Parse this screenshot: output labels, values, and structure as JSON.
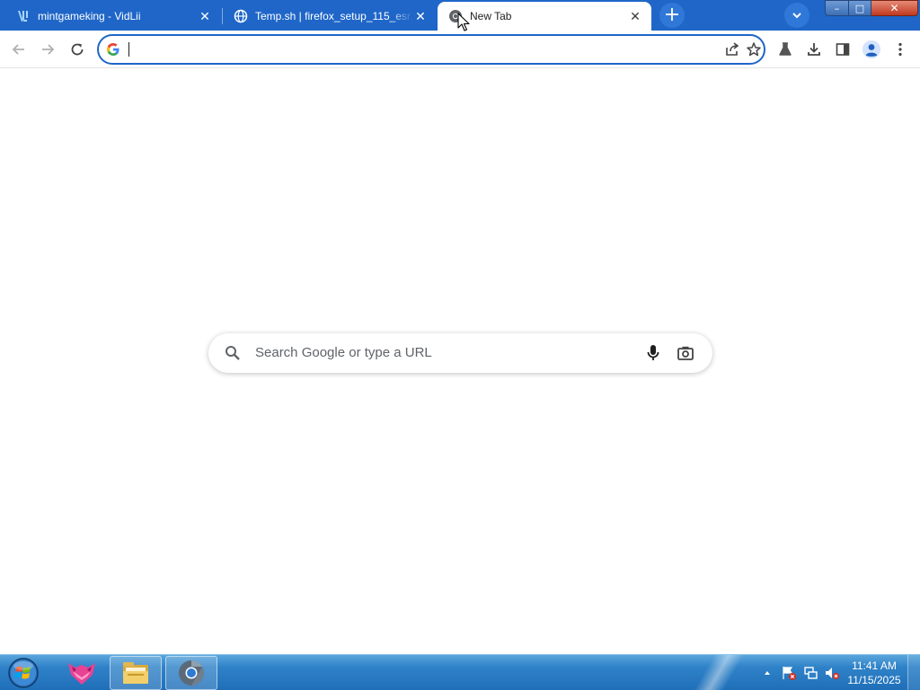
{
  "browser": {
    "tabs": [
      {
        "title": "mintgameking - VidLii",
        "favicon": "vidlii-icon",
        "active": false
      },
      {
        "title": "Temp.sh | firefox_setup_115_esr.e",
        "favicon": "globe-icon",
        "active": false
      },
      {
        "title": "New Tab",
        "favicon": "chrome-icon",
        "active": true
      }
    ],
    "new_tab_symbol": "+",
    "window_controls": {
      "minimize": "–",
      "maximize": "□",
      "close": "✕"
    }
  },
  "toolbar": {
    "address_value": "",
    "buttons": [
      "back-icon",
      "forward-icon",
      "reload-icon",
      "share-icon",
      "bookmark-star-icon",
      "labs-flask-icon",
      "download-icon",
      "side-panel-icon",
      "profile-icon",
      "menu-icon"
    ]
  },
  "ntp": {
    "search_placeholder": "Search Google or type a URL"
  },
  "taskbar": {
    "clock_time": "11:41 AM",
    "clock_date": "11/15/2025",
    "pinned": [
      "start-orb-icon",
      "app-fox-icon",
      "file-explorer-icon",
      "chrome-icon"
    ]
  },
  "colors": {
    "tabstrip": "#1f66c8",
    "omnibox_border": "#1f66c8",
    "taskbar": "#2f82c8"
  }
}
